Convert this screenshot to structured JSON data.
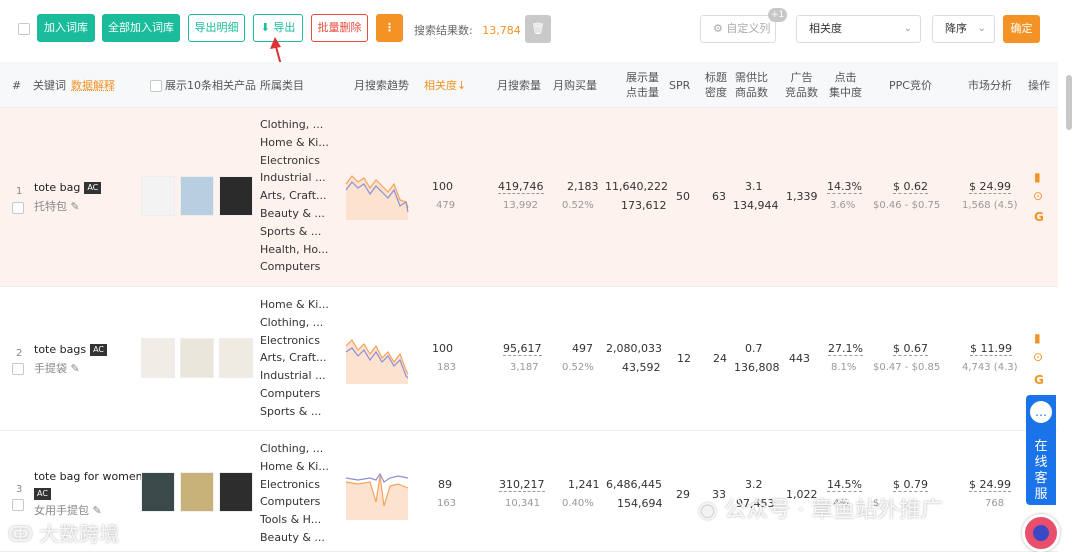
{
  "toolbar": {
    "add_to_dict": "加入词库",
    "add_all_to_dict": "全部加入词库",
    "export_details": "导出明细",
    "export": "导出",
    "batch_delete": "批量删除",
    "more": "⋮",
    "result_label": "搜索结果数:",
    "result_count": "13,784",
    "custom_columns": "自定义列",
    "custom_badge": "+1",
    "sort_field": "相关度",
    "sort_order": "降序",
    "confirm": "确定"
  },
  "header": {
    "index": "#",
    "keyword": "关键词",
    "data_explain": "数据解释",
    "show_products": "展示10条相关产品",
    "category": "所属类目",
    "trend": "月搜索趋势",
    "relevance": "相关度↓",
    "monthly_search": "月搜索量",
    "monthly_purchase": "月购买量",
    "impressions_clicks": [
      "展示量",
      "点击量"
    ],
    "spr": "SPR",
    "title_density": [
      "标题",
      "密度"
    ],
    "supply_demand": [
      "需供比",
      "商品数"
    ],
    "ad_products": [
      "广告",
      "竞品数"
    ],
    "click_concentration": [
      "点击",
      "集中度"
    ],
    "ppc": "PPC竞价",
    "market": "市场分析",
    "ops": "操作"
  },
  "rows": [
    {
      "index": "1",
      "keyword": "tote bag",
      "ac": "AC",
      "keyword_cn": "托特包",
      "categories": [
        "Clothing, ...",
        "Home & Ki...",
        "Electronics",
        "Industrial ...",
        "Arts, Craft...",
        "Beauty & ...",
        "Sports & ...",
        "Health, Ho...",
        "Computers"
      ],
      "relevance": "100",
      "relevance_sub": "479",
      "monthly_search": "419,746",
      "monthly_search_sub": "13,992",
      "monthly_purchase": "2,183",
      "purchase_rate": "0.52%",
      "impressions": "11,640,222",
      "clicks": "173,612",
      "spr": "50",
      "title_density": "63",
      "supply_demand": "3.1",
      "product_count": "134,944",
      "ad_products": "1,339",
      "click_conc": "14.3%",
      "click_conc_sub": "3.6%",
      "ppc": "$ 0.62",
      "ppc_range": "$0.46 - $0.75",
      "market_price": "$ 24.99",
      "market_sub": "1,568 (4.5)"
    },
    {
      "index": "2",
      "keyword": "tote bags",
      "ac": "AC",
      "keyword_cn": "手提袋",
      "categories": [
        "Home & Ki...",
        "Clothing, ...",
        "Electronics",
        "Arts, Craft...",
        "Industrial ...",
        "Computers",
        "Sports & ..."
      ],
      "relevance": "100",
      "relevance_sub": "183",
      "monthly_search": "95,617",
      "monthly_search_sub": "3,187",
      "monthly_purchase": "497",
      "purchase_rate": "0.52%",
      "impressions": "2,080,033",
      "clicks": "43,592",
      "spr": "12",
      "title_density": "24",
      "supply_demand": "0.7",
      "product_count": "136,808",
      "ad_products": "443",
      "click_conc": "27.1%",
      "click_conc_sub": "8.1%",
      "ppc": "$ 0.67",
      "ppc_range": "$0.47 - $0.85",
      "market_price": "$ 11.99",
      "market_sub": "4,743 (4.3)"
    },
    {
      "index": "3",
      "keyword": "tote bag for women",
      "ac": "AC",
      "keyword_cn": "女用手提包",
      "categories": [
        "Clothing, ...",
        "Home & Ki...",
        "Electronics",
        "Computers",
        "Tools & H...",
        "Beauty & ..."
      ],
      "relevance": "89",
      "relevance_sub": "163",
      "monthly_search": "310,217",
      "monthly_search_sub": "10,341",
      "monthly_purchase": "1,241",
      "purchase_rate": "0.40%",
      "impressions": "6,486,445",
      "clicks": "154,694",
      "spr": "29",
      "title_density": "33",
      "supply_demand": "3.2",
      "product_count": "97,453",
      "ad_products": "1,022",
      "click_conc": "14.5%",
      "click_conc_sub": "4%",
      "ppc": "$ 0.79",
      "ppc_range": "$",
      "market_price": "$ 24.99",
      "market_sub": "768"
    }
  ],
  "side": {
    "service_label": "在线客服"
  },
  "watermark": {
    "left": "大数跨境",
    "right": "公众号 · 章鱼站外推广"
  },
  "colors": {
    "green": "#1abc9c",
    "orange": "#f39325",
    "red": "#e74c3c",
    "blue": "#1a73e8"
  }
}
